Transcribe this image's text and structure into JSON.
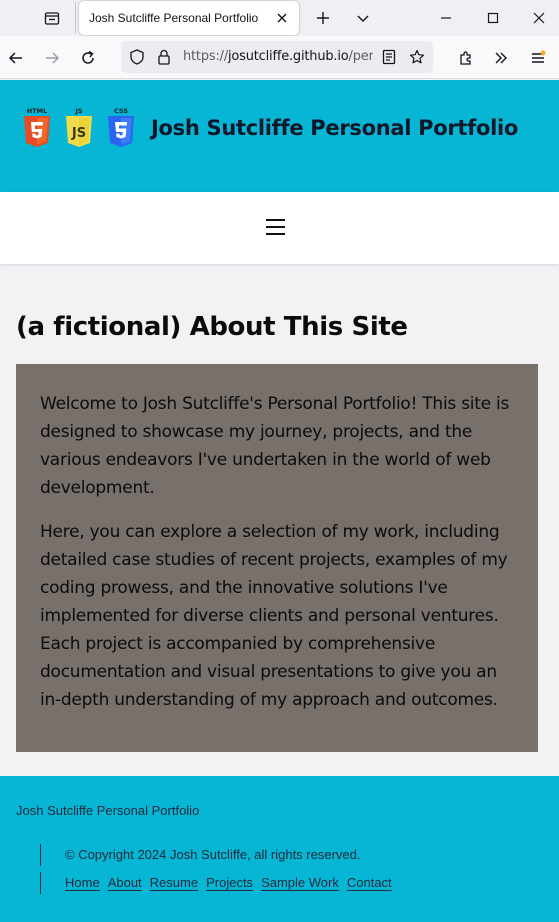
{
  "browser": {
    "tab_title": "Josh Sutcliffe Personal Portfolio",
    "url_prefix": "https://",
    "url_host": "josutcliffe.github.io",
    "url_path": "/pers"
  },
  "header": {
    "site_title": "Josh Sutcliffe Personal Portfolio",
    "logos": [
      {
        "label": "HTML",
        "glyph": "5",
        "color": "#e34c26"
      },
      {
        "label": "JS",
        "glyph": "JS",
        "color": "#f0db4f"
      },
      {
        "label": "CSS",
        "glyph": "3",
        "color": "#2965f1"
      }
    ]
  },
  "main": {
    "heading": "(a fictional) About This Site",
    "paragraphs": [
      "Welcome to Josh Sutcliffe's Personal Portfolio! This site is designed to showcase my journey, projects, and the various endeavors I've undertaken in the world of web development.",
      "Here, you can explore a selection of my work, including detailed case studies of recent projects, examples of my coding prowess, and the innovative solutions I've implemented for diverse clients and personal ventures. Each project is accompanied by comprehensive documentation and visual presentations to give you an in-depth understanding of my approach and outcomes."
    ]
  },
  "footer": {
    "name": "Josh Sutcliffe Personal Portfolio",
    "copyright": "© Copyright 2024 Josh Sutcliffe, all rights reserved.",
    "links": [
      "Home",
      "About",
      "Resume",
      "Projects",
      "Sample Work",
      "Contact"
    ]
  },
  "colors": {
    "accent": "#06b6d4",
    "content_box": "#78706b"
  }
}
